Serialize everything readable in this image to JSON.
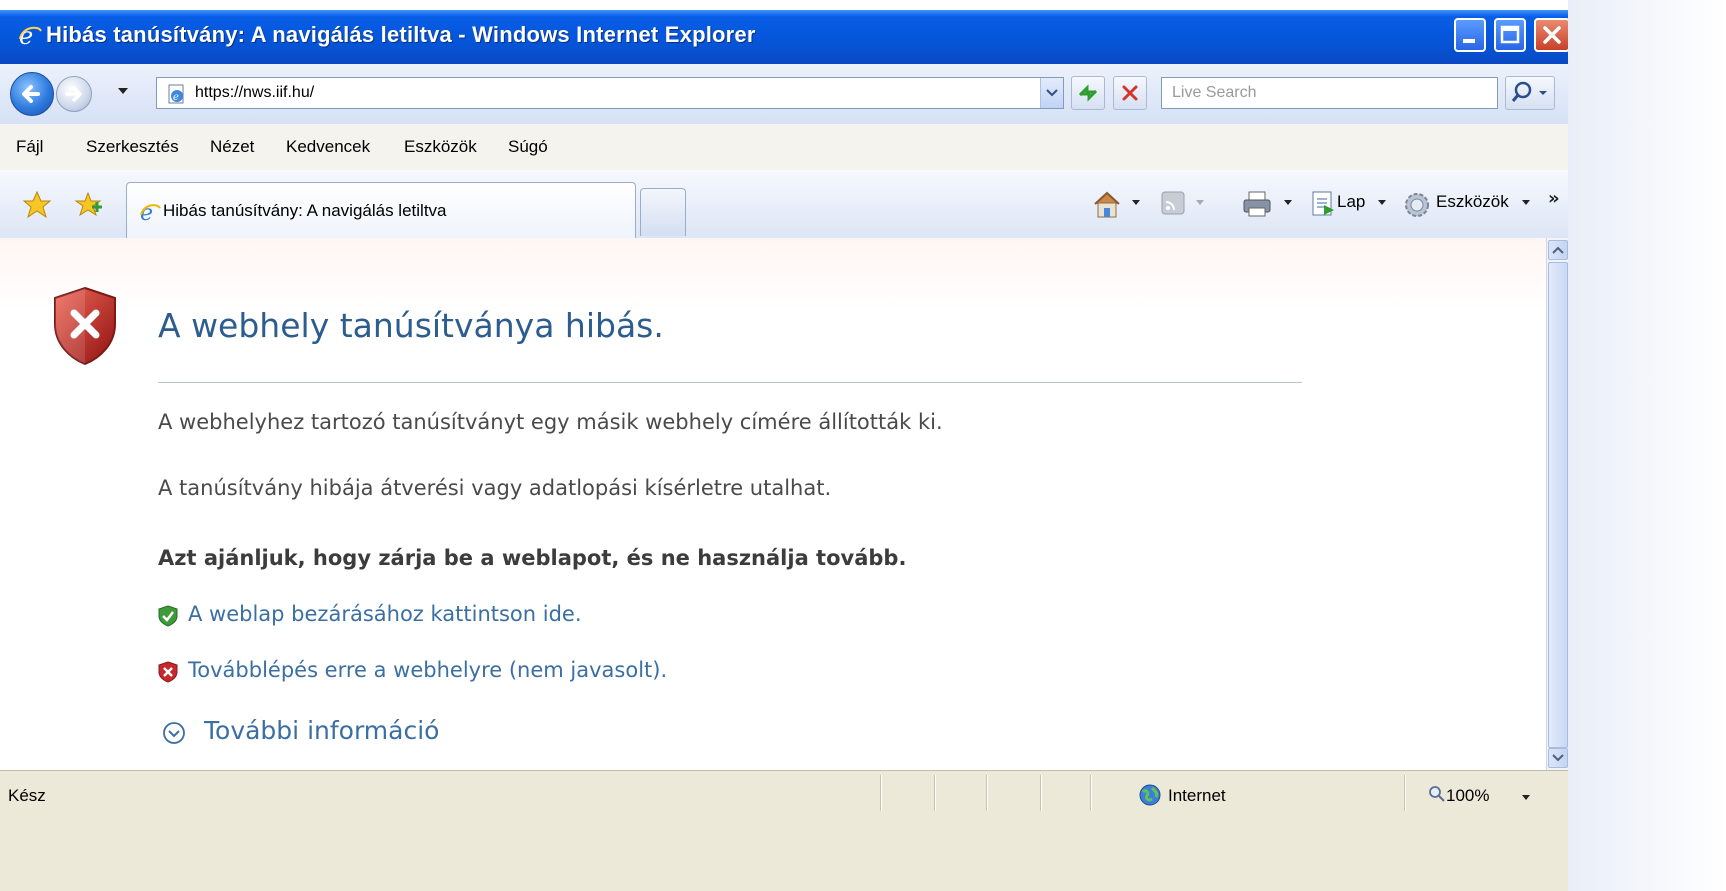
{
  "window": {
    "title": "Hibás tanúsítvány: A navigálás letiltva - Windows Internet Explorer"
  },
  "address_bar": {
    "url": "https://nws.iif.hu/",
    "search_placeholder": "Live Search"
  },
  "menu": {
    "items": [
      "Fájl",
      "Szerkesztés",
      "Nézet",
      "Kedvencek",
      "Eszközök",
      "Súgó"
    ]
  },
  "tabs": {
    "active_label": "Hibás tanúsítvány: A navigálás letiltva"
  },
  "command_bar": {
    "page_label": "Lap",
    "tools_label": "Eszközök",
    "overflow": "»"
  },
  "content": {
    "title": "A webhely tanúsítványa hibás.",
    "paragraph1": "A webhelyhez tartozó tanúsítványt egy másik webhely címére állították ki.",
    "paragraph2": "A tanúsítvány hibája átverési vagy adatlopási kísérletre utalhat.",
    "recommendation": "Azt ajánljuk, hogy zárja be a weblapot, és ne használja tovább.",
    "close_link": "A weblap bezárásához kattintson ide.",
    "continue_link": "Továbblépés erre a webhelyre (nem javasolt).",
    "more_info": "További információ"
  },
  "status_bar": {
    "status": "Kész",
    "zone": "Internet",
    "zoom": "100%"
  },
  "colors": {
    "title_bar": "#0558de",
    "heading": "#2d5c8f",
    "link": "#3b6fa3",
    "error_red": "#c8282c",
    "safe_green": "#3f9a3a"
  },
  "icons": [
    "ie-logo-icon",
    "back-arrow-icon",
    "forward-arrow-icon",
    "page-icon",
    "refresh-icon",
    "stop-icon",
    "search-icon",
    "favorites-star-icon",
    "add-favorites-icon",
    "home-icon",
    "feeds-icon",
    "print-icon",
    "page-menu-icon",
    "tools-gear-icon",
    "error-shield-icon",
    "green-shield-icon",
    "red-shield-icon",
    "expand-circle-icon",
    "globe-icon",
    "zoom-icon"
  ]
}
